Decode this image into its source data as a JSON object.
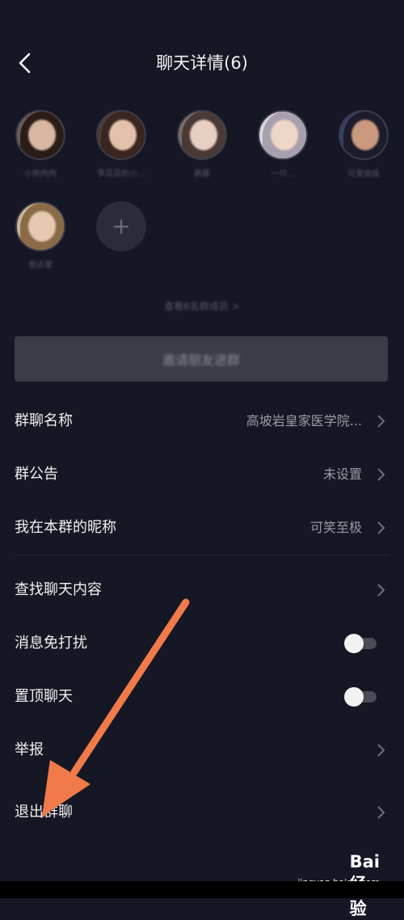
{
  "header": {
    "title": "聊天详情(6)"
  },
  "members": [
    {
      "name": "小熊肉肉"
    },
    {
      "name": "李蕊蕊的小..."
    },
    {
      "name": "慕慕"
    },
    {
      "name": "一只..."
    },
    {
      "name": "可爱娃娃"
    },
    {
      "name": "我达蒙"
    }
  ],
  "view_all": "查看6名群成员 >",
  "invite_label": "邀请朋友进群",
  "settings": {
    "group_name": {
      "label": "群聊名称",
      "value": "高坡岩皇家医学院..."
    },
    "announcement": {
      "label": "群公告",
      "value": "未设置"
    },
    "nickname": {
      "label": "我在本群的昵称",
      "value": "可笑至极"
    },
    "search": {
      "label": "查找聊天内容"
    },
    "mute": {
      "label": "消息免打扰",
      "enabled": false
    },
    "pin": {
      "label": "置顶聊天",
      "enabled": false
    },
    "report": {
      "label": "举报"
    },
    "leave": {
      "label": "退出群聊"
    }
  },
  "watermark": {
    "logo": "Bai 经验",
    "url": "jingyan.baidu.com"
  },
  "colors": {
    "background": "#161724",
    "arrow": "#f07a4a",
    "muted_text": "#9a9ba6"
  }
}
